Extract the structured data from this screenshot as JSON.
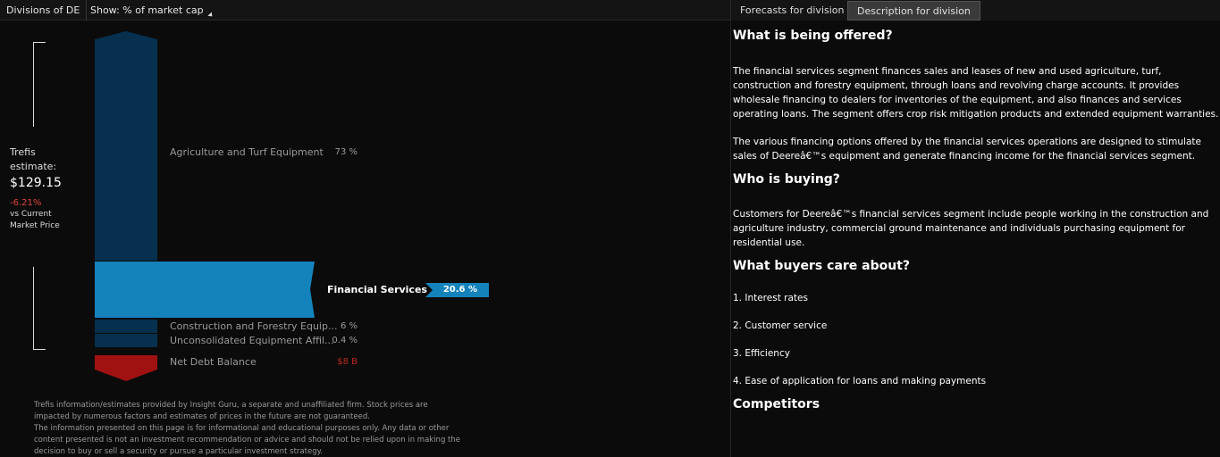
{
  "header": {
    "divisions_label": "Divisions of DE",
    "show_label": "Show: % of market cap"
  },
  "estimate": {
    "label": "Trefis estimate:",
    "price": "$129.15",
    "change": "-6.21%",
    "vs_label": "vs Current Market Price"
  },
  "divisions": [
    {
      "name": "Agriculture and Turf Equipment",
      "value": "73 %"
    },
    {
      "name": "Financial Services",
      "value": "20.6 %"
    },
    {
      "name": "Construction and Forestry Equip...",
      "value": "6 %"
    },
    {
      "name": "Unconsolidated Equipment Affil...",
      "value": "0.4 %"
    },
    {
      "name": "Net Debt Balance",
      "value": "$8 B"
    }
  ],
  "colors": {
    "bar_dark": "#06304d",
    "bar_active": "#1483bc",
    "bar_debt": "#a01212",
    "debt_value": "#c0281e"
  },
  "disclaimer": [
    "Trefis information/estimates provided by Insight Guru, a separate and unaffiliated firm. Stock prices are impacted by numerous factors and estimates of prices in the future are not guaranteed.",
    "The information presented on this page is for informational and educational purposes only. Any data or other content presented is not an investment recommendation or advice and should not be relied upon in making the decision to buy or sell a security or pursue a particular investment strategy."
  ],
  "tabs": {
    "forecasts": "Forecasts for division",
    "description": "Description for division"
  },
  "description": {
    "h1": "What is being offered?",
    "p1": "The financial services segment finances sales and leases of new and used agriculture, turf, construction and forestry equipment, through loans and revolving charge accounts. It provides wholesale financing to dealers for inventories of the equipment, and also finances and services operating loans. The segment offers crop risk mitigation products and extended equipment warranties.",
    "p2": "The various financing options offered by the financial services operations are designed to stimulate sales of Deereâ€™s equipment and generate financing income for the financial services segment.",
    "h2": "Who is buying?",
    "p3": "Customers for Deereâ€™s financial services segment include people working in the construction and agriculture industry, commercial ground maintenance and individuals purchasing equipment for residential use.",
    "h3": "What buyers care about?",
    "care": [
      "1. Interest rates",
      "2. Customer service",
      "3. Efficiency",
      "4. Ease of application for loans and making payments"
    ],
    "h4": "Competitors"
  }
}
